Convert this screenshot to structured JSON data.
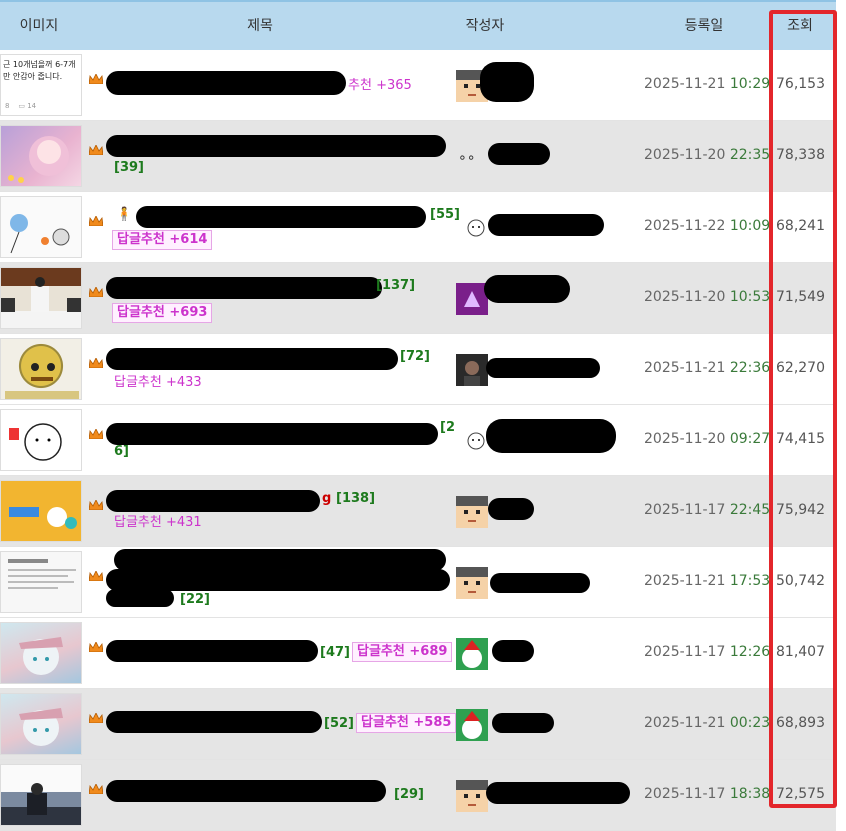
{
  "header": {
    "image": "이미지",
    "title": "제목",
    "author": "작성자",
    "date": "등록일",
    "views": "조회"
  },
  "rows": [
    {
      "thumb_text": "근 10개넘을꺼 6-7개만 안감아 줍니다.",
      "title_tail": "추천",
      "comments": "",
      "rec_label": "",
      "rec_value": "+365",
      "date": "2025-11-21",
      "time": "10:29",
      "views": "76,153"
    },
    {
      "thumb_text": "",
      "title_tail": "",
      "comments": "[39]",
      "rec_label": "",
      "rec_value": "",
      "date": "2025-11-20",
      "time": "22:35",
      "views": "78,338"
    },
    {
      "thumb_text": "",
      "title_tail": "",
      "comments": "[55]",
      "rec_label": "답글추천",
      "rec_value": "+614",
      "date": "2025-11-22",
      "time": "10:09",
      "views": "68,241"
    },
    {
      "thumb_text": "",
      "title_tail": "",
      "comments": "[137]",
      "rec_label": "답글추천",
      "rec_value": "+693",
      "date": "2025-11-20",
      "time": "10:53",
      "views": "71,549"
    },
    {
      "thumb_text": "",
      "title_tail": "",
      "comments": "[72]",
      "rec_label": "답글추천",
      "rec_value": "+433",
      "date": "2025-11-21",
      "time": "22:36",
      "views": "62,270"
    },
    {
      "thumb_text": "",
      "title_tail": "",
      "comments_a": "[2",
      "comments_b": "6]",
      "rec_label": "",
      "rec_value": "",
      "date": "2025-11-20",
      "time": "09:27",
      "views": "74,415"
    },
    {
      "thumb_text": "",
      "title_tail": "g",
      "comments": "[138]",
      "rec_label": "답글추천",
      "rec_value": "+431",
      "date": "2025-11-17",
      "time": "22:45",
      "views": "75,942"
    },
    {
      "thumb_text": "",
      "title_tail": "",
      "comments": "[22]",
      "rec_label": "",
      "rec_value": "",
      "date": "2025-11-21",
      "time": "17:53",
      "views": "50,742"
    },
    {
      "thumb_text": "",
      "title_tail": "",
      "comments": "[47]",
      "rec_label": "답글추천",
      "rec_value": "+689",
      "date": "2025-11-17",
      "time": "12:26",
      "views": "81,407"
    },
    {
      "thumb_text": "",
      "title_tail": "",
      "comments": "[52]",
      "rec_label": "답글추천",
      "rec_value": "+585",
      "date": "2025-11-21",
      "time": "00:23",
      "views": "68,893"
    },
    {
      "thumb_text": "",
      "title_tail": "",
      "comments": "[29]",
      "rec_label": "",
      "rec_value": "",
      "date": "2025-11-17",
      "time": "18:38",
      "views": "72,575"
    }
  ],
  "colors": {
    "header_bg": "#b8d9ee",
    "alt_row": "#e5e5e5",
    "highlight": "#e3262b",
    "comment": "#1d7a1d",
    "recommend": "#cc33cc"
  }
}
